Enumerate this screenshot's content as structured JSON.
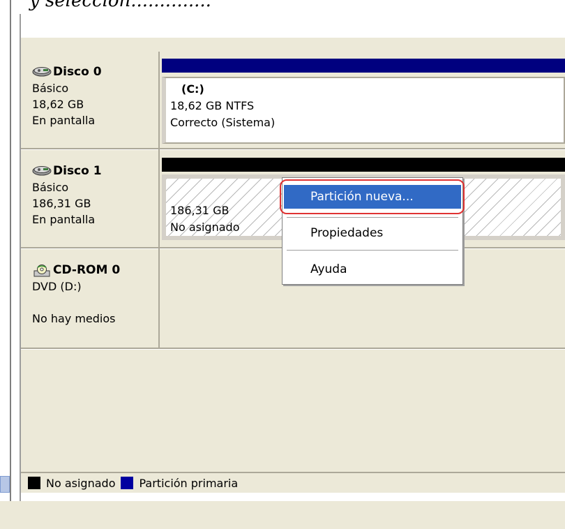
{
  "caption": {
    "text": "y selección.............."
  },
  "disks": [
    {
      "name": "Disco 0",
      "type": "Básico",
      "size": "18,62 GB",
      "status": "En pantalla",
      "icon": "hard-disk-icon",
      "partition": {
        "header_color": "#00007f",
        "label": "(C:)",
        "detail": "18,62 GB NTFS",
        "state": "Correcto (Sistema)"
      }
    },
    {
      "name": "Disco 1",
      "type": "Básico",
      "size": "186,31 GB",
      "status": "En pantalla",
      "icon": "hard-disk-icon",
      "partition": {
        "header_color": "#000000",
        "detail": "186,31 GB",
        "state": "No asignado"
      }
    },
    {
      "name": "CD-ROM 0",
      "type": "DVD (D:)",
      "status": "No hay medios",
      "icon": "cdrom-icon"
    }
  ],
  "context_menu": {
    "items": [
      {
        "label": "Partición nueva...",
        "selected": true
      },
      {
        "label": "Propiedades",
        "selected": false
      },
      {
        "label": "Ayuda",
        "selected": false
      }
    ],
    "highlight_color": "#e03232",
    "selected_color": "#316ac5"
  },
  "legend": [
    {
      "label": "No asignado",
      "color": "#000000"
    },
    {
      "label": "Partición primaria",
      "color": "#0000a0"
    }
  ]
}
